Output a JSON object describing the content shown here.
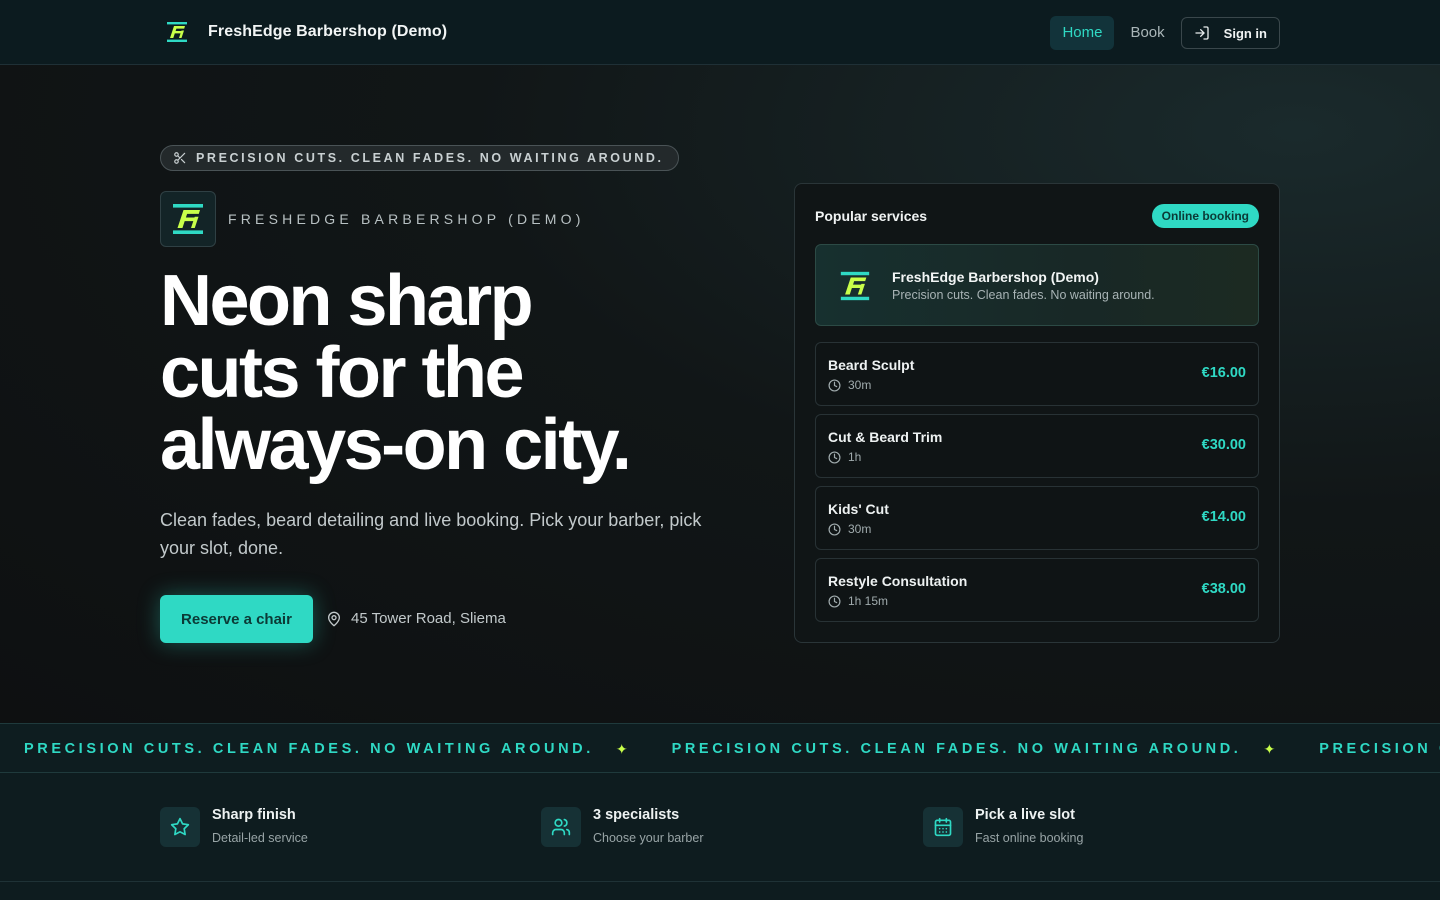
{
  "header": {
    "brand_name": "FreshEdge Barbershop (Demo)",
    "nav": {
      "home": "Home",
      "book": "Book",
      "sign_in": "Sign in"
    }
  },
  "hero": {
    "tagline": "PRECISION CUTS. CLEAN FADES. NO WAITING AROUND.",
    "brand_label": "FRESHEDGE BARBERSHOP (DEMO)",
    "title_lines": [
      "Neon sharp",
      "cuts for the",
      "always-on city."
    ],
    "subtitle": "Clean fades, beard detailing and live booking. Pick your barber, pick your slot, done.",
    "cta_label": "Reserve a chair",
    "address": "45 Tower Road, Sliema"
  },
  "services_card": {
    "title": "Popular services",
    "badge": "Online booking",
    "shop": {
      "name": "FreshEdge Barbershop (Demo)",
      "tagline": "Precision cuts. Clean fades. No waiting around."
    },
    "services": [
      {
        "name": "Beard Sculpt",
        "duration": "30m",
        "price": "€16.00"
      },
      {
        "name": "Cut & Beard Trim",
        "duration": "1h",
        "price": "€30.00"
      },
      {
        "name": "Kids' Cut",
        "duration": "30m",
        "price": "€14.00"
      },
      {
        "name": "Restyle Consultation",
        "duration": "1h 15m",
        "price": "€38.00"
      }
    ]
  },
  "marquee": {
    "items": [
      "PRECISION CUTS. CLEAN FADES. NO WAITING AROUND.",
      "PRECISION CUTS. CLEAN FADES. NO WAITING AROUND.",
      "PRECISION CUTS. CLEAN FADES. NO WAITING AROUND."
    ],
    "separator": "✦"
  },
  "features": [
    {
      "title": "Sharp finish",
      "subtitle": "Detail-led service",
      "icon": "star-icon"
    },
    {
      "title": "3 specialists",
      "subtitle": "Choose your barber",
      "icon": "users-icon"
    },
    {
      "title": "Pick a live slot",
      "subtitle": "Fast online booking",
      "icon": "calendar-icon"
    }
  ],
  "colors": {
    "accent": "#2fd9c4",
    "lime": "#c8ff4a",
    "header_bg": "#0c1b1f",
    "page_bg": "#0d1214"
  }
}
